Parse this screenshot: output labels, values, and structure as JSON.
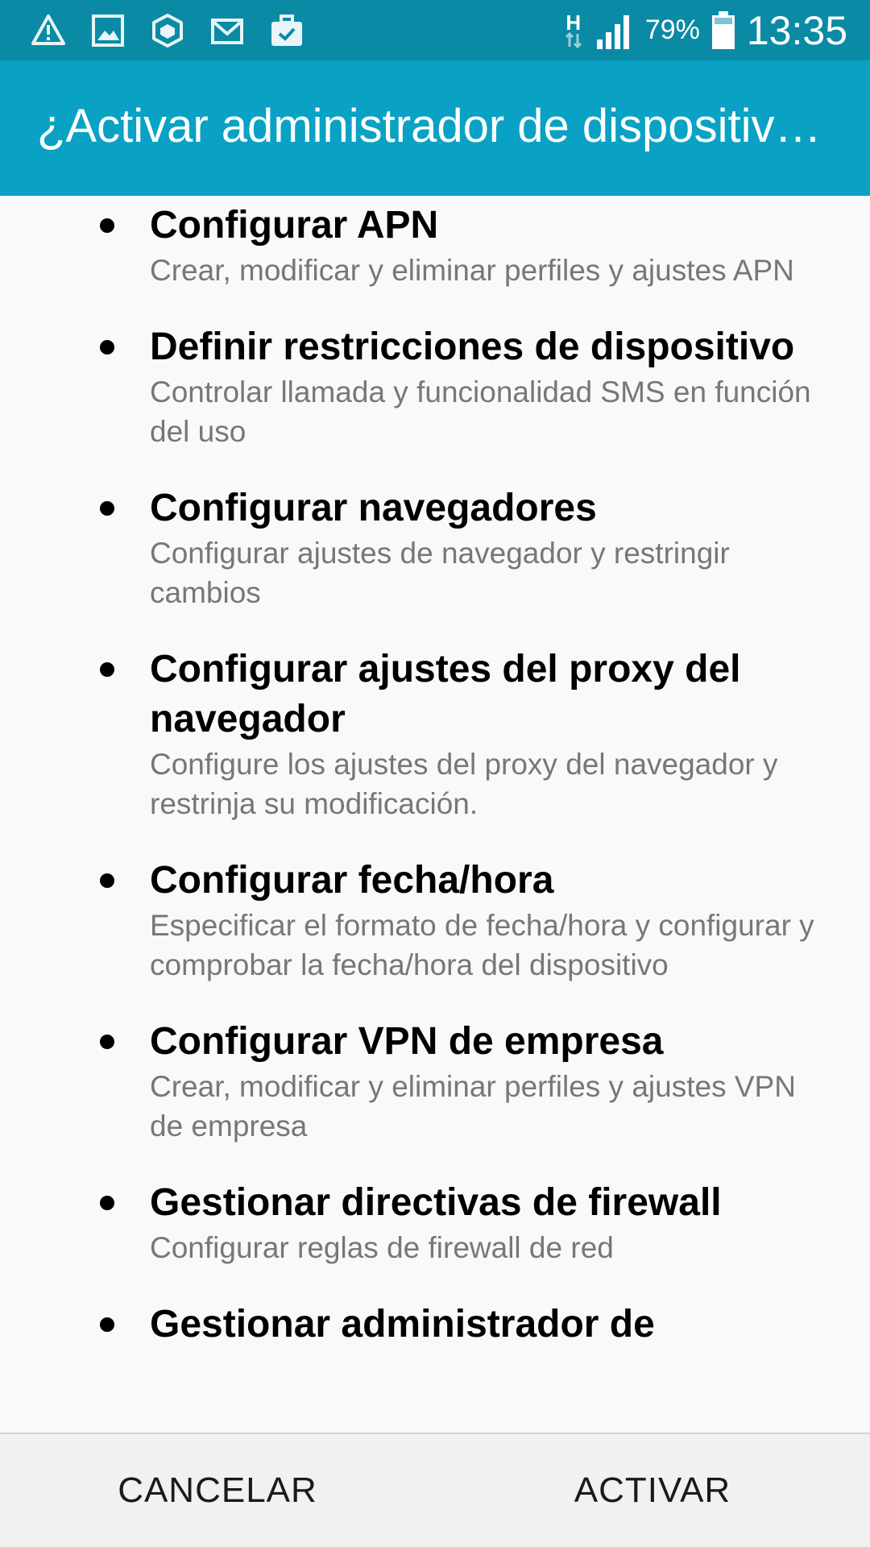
{
  "status_bar": {
    "left_icons": [
      "warning-icon",
      "image-icon",
      "package-icon",
      "email-icon",
      "briefcase-check-icon"
    ],
    "network_type": "H",
    "battery_percent": "79%",
    "time": "13:35"
  },
  "dialog": {
    "title": "¿Activar administrador de dispositivos?",
    "permissions": [
      {
        "title": "Configurar APN",
        "description": "Crear, modificar y eliminar perfiles y ajustes APN"
      },
      {
        "title": "Definir restricciones de dispositivo",
        "description": "Controlar llamada y funcionalidad SMS en función del uso"
      },
      {
        "title": "Configurar navegadores",
        "description": "Configurar ajustes de navegador y restringir cambios"
      },
      {
        "title": "Configurar ajustes del proxy del navegador",
        "description": "Configure los ajustes del proxy del navegador y restrinja su modificación."
      },
      {
        "title": "Configurar fecha/hora",
        "description": "Especificar el formato de fecha/hora y configurar y comprobar la fecha/hora del dispositivo"
      },
      {
        "title": "Configurar VPN de empresa",
        "description": "Crear, modificar y eliminar perfiles y ajustes VPN de empresa"
      },
      {
        "title": "Gestionar directivas de firewall",
        "description": "Configurar reglas de firewall de red"
      },
      {
        "title": "Gestionar administrador de",
        "description": ""
      }
    ],
    "cancel_label": "CANCELAR",
    "activate_label": "ACTIVAR"
  },
  "colors": {
    "status_bar": "#0a8aa5",
    "title_bar": "#09a2c4",
    "background": "#f9f9f9",
    "footer": "#f1f1f1"
  }
}
